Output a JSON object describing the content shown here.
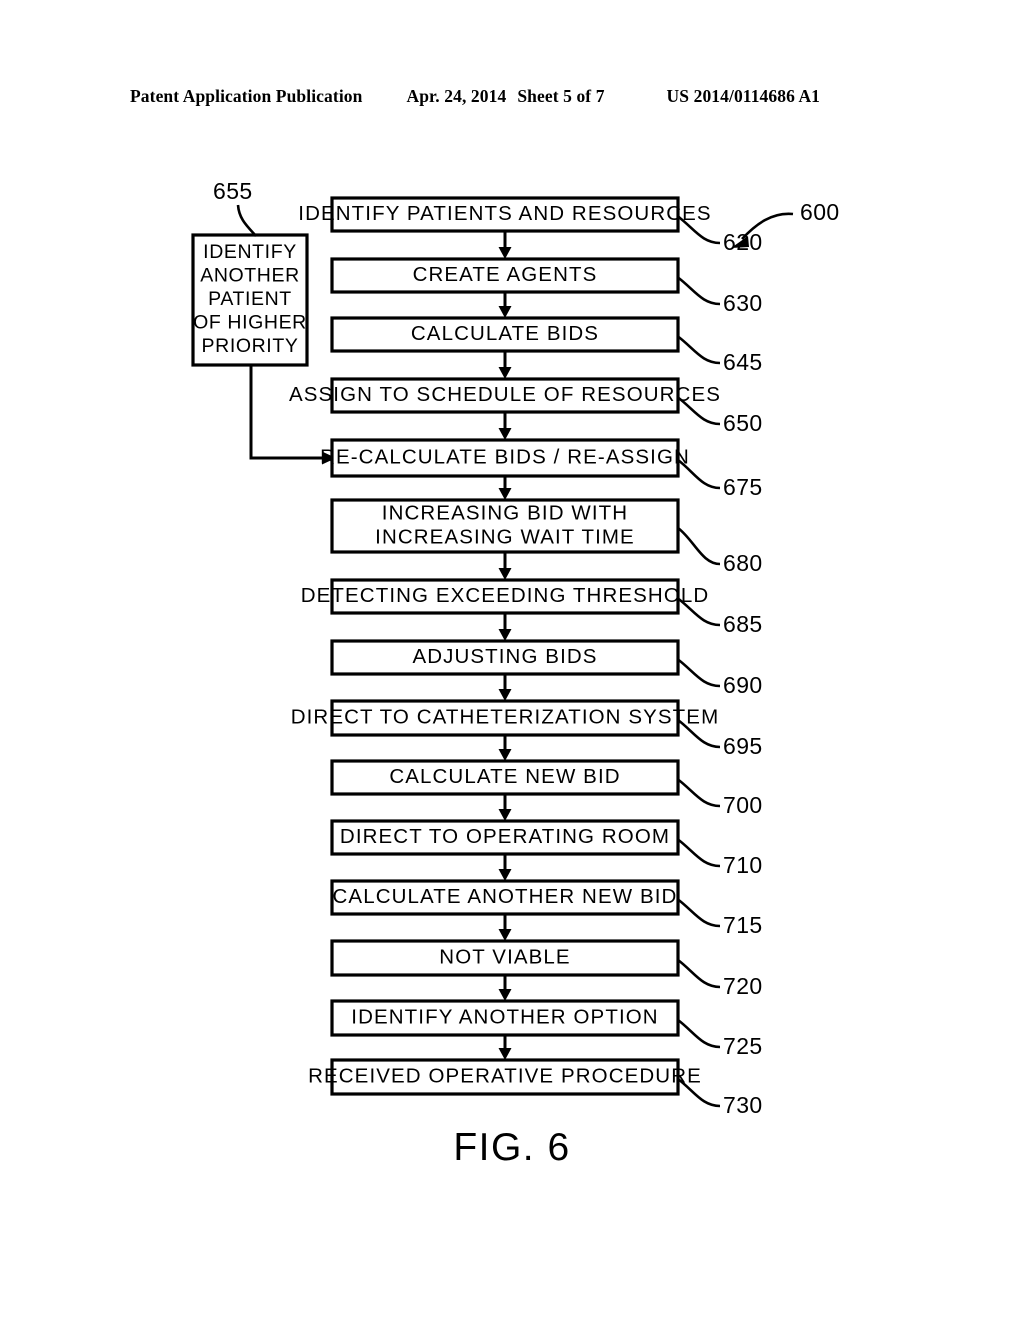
{
  "header": {
    "publication": "Patent Application Publication",
    "date": "Apr. 24, 2014",
    "sheet": "Sheet 5 of 7",
    "patent_number": "US 2014/0114686 A1"
  },
  "figure": {
    "caption": "FIG. 6",
    "diagram_ref": "600",
    "side_box": {
      "ref": "655",
      "lines": [
        "IDENTIFY",
        "ANOTHER",
        "PATIENT",
        "OF HIGHER",
        "PRIORITY"
      ]
    },
    "steps": [
      {
        "ref": "620",
        "lines": [
          "IDENTIFY PATIENTS AND  RESOURCES"
        ]
      },
      {
        "ref": "630",
        "lines": [
          "CREATE AGENTS"
        ]
      },
      {
        "ref": "645",
        "lines": [
          "CALCULATE BIDS"
        ]
      },
      {
        "ref": "650",
        "lines": [
          "ASSIGN TO SCHEDULE OF RESOURCES"
        ]
      },
      {
        "ref": "675",
        "lines": [
          "RE-CALCULATE BIDS / RE-ASSIGN"
        ]
      },
      {
        "ref": "680",
        "lines": [
          "INCREASING BID WITH",
          "INCREASING WAIT TIME"
        ]
      },
      {
        "ref": "685",
        "lines": [
          "DETECTING EXCEEDING THRESHOLD"
        ]
      },
      {
        "ref": "690",
        "lines": [
          "ADJUSTING BIDS"
        ]
      },
      {
        "ref": "695",
        "lines": [
          "DIRECT TO CATHETERIZATION SYSTEM"
        ]
      },
      {
        "ref": "700",
        "lines": [
          "CALCULATE NEW  BID"
        ]
      },
      {
        "ref": "710",
        "lines": [
          "DIRECT TO OPERATING ROOM"
        ]
      },
      {
        "ref": "715",
        "lines": [
          "CALCULATE ANOTHER NEW  BID"
        ]
      },
      {
        "ref": "720",
        "lines": [
          "NOT VIABLE"
        ]
      },
      {
        "ref": "725",
        "lines": [
          "IDENTIFY ANOTHER OPTION"
        ]
      },
      {
        "ref": "730",
        "lines": [
          "RECEIVED OPERATIVE PROCEDURE"
        ]
      }
    ]
  }
}
